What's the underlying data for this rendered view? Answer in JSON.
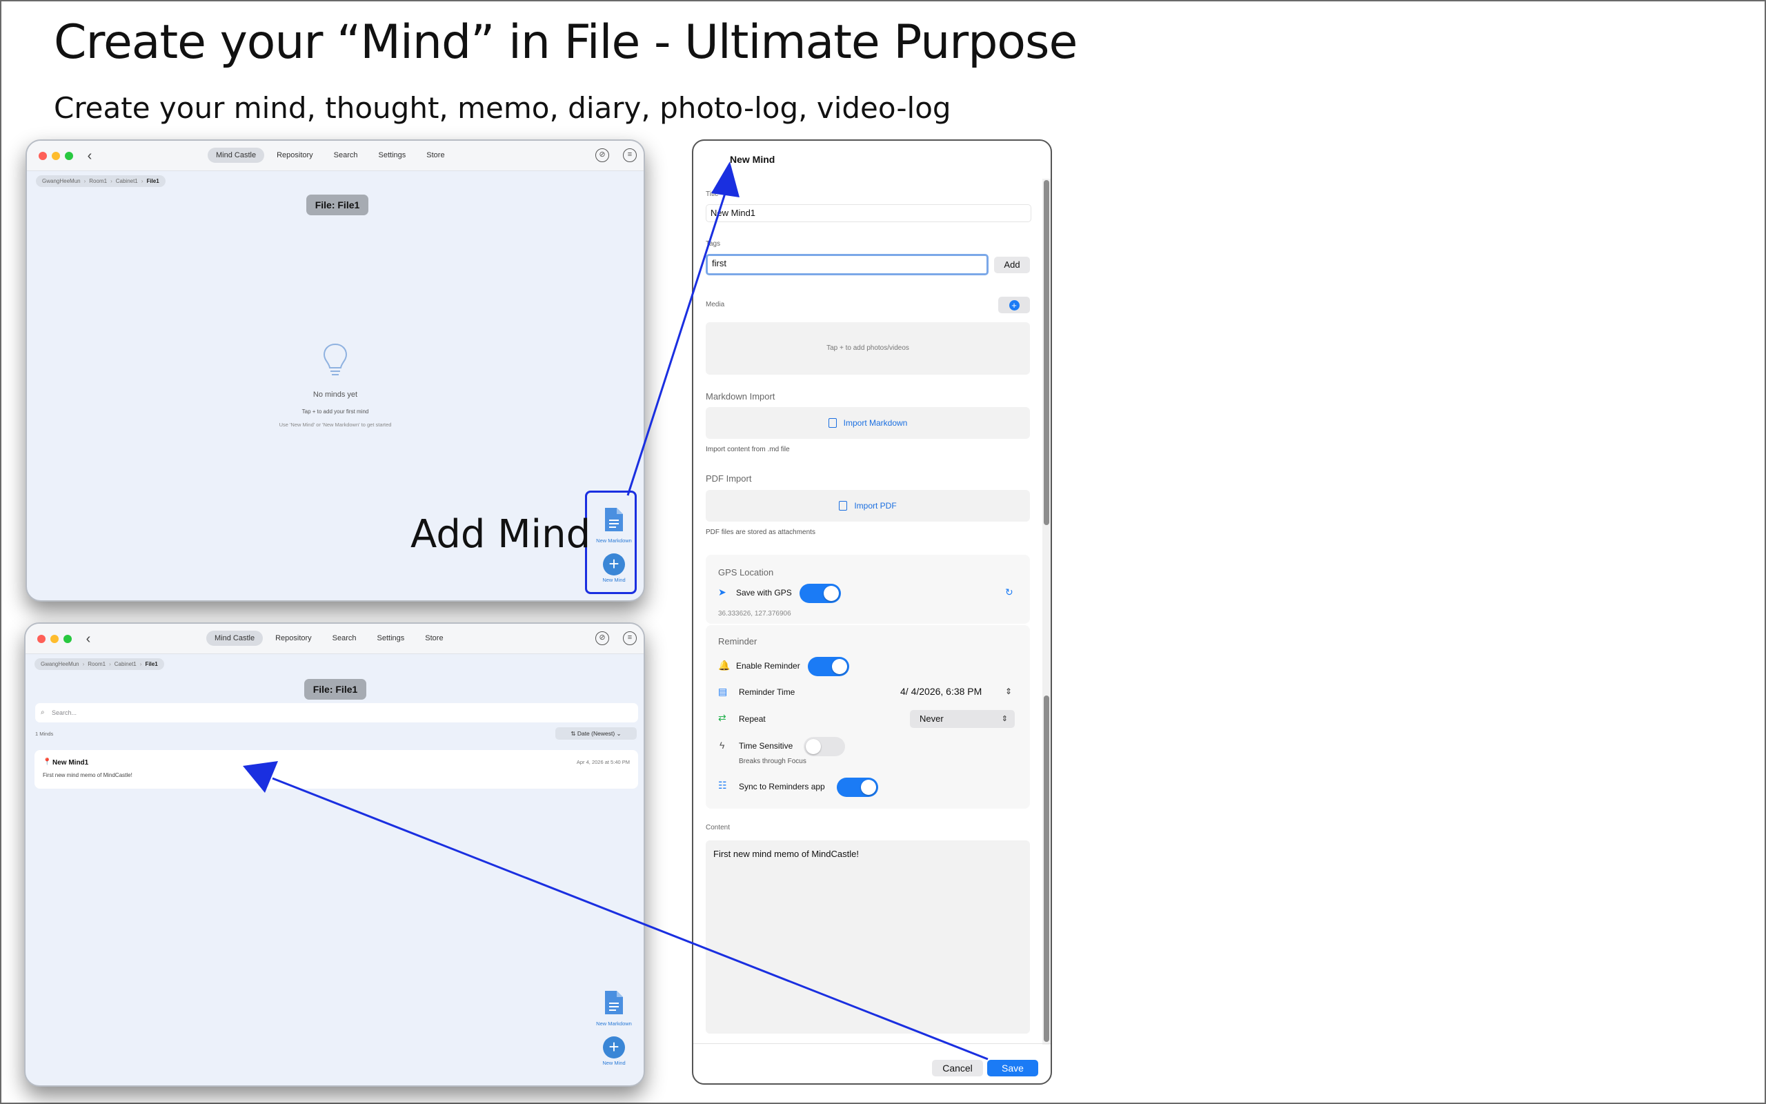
{
  "headline": "Create your “Mind” in File - Ultimate Purpose",
  "subline": "Create your mind, thought, memo, diary, photo-log, video-log",
  "add_mind_caption": "Add Mind",
  "app": {
    "tabs": [
      "Mind Castle",
      "Repository",
      "Search",
      "Settings",
      "Store"
    ],
    "active_tab": "Mind Castle",
    "back_icon": "chevron-left-icon",
    "breadcrumb": [
      "GwangHeeMun",
      "Room1",
      "Cabinet1",
      "File1"
    ],
    "file_title": "File: File1",
    "fab": {
      "markdown_label": "New Markdown",
      "mind_label": "New Mind"
    }
  },
  "window_empty": {
    "empty_title": "No minds yet",
    "empty_subtitle": "Tap + to add your first mind",
    "empty_hint": "Use 'New Mind' or 'New Markdown' to get started"
  },
  "window_list": {
    "search_placeholder": "Search...",
    "count_label": "1 Minds",
    "sort_label": "Date (Newest)",
    "minds": [
      {
        "title": "New Mind1",
        "date": "Apr 4, 2026 at 5:40 PM",
        "body": "First new mind memo of MindCastle!"
      }
    ]
  },
  "sheet": {
    "title": "New Mind",
    "title_label": "Title",
    "title_value": "New Mind1",
    "tags_label": "Tags",
    "tags_value": "first",
    "add_label": "Add",
    "media_label": "Media",
    "media_hint": "Tap + to add photos/videos",
    "markdown_import_label": "Markdown Import",
    "import_markdown_button": "Import Markdown",
    "markdown_note": "Import content from .md file",
    "pdf_import_label": "PDF Import",
    "import_pdf_button": "Import PDF",
    "pdf_note": "PDF files are stored as attachments",
    "gps_label": "GPS Location",
    "save_with_gps": "Save with GPS",
    "save_with_gps_on": true,
    "coords": "36.333626, 127.376906",
    "reminder_label": "Reminder",
    "enable_reminder": "Enable Reminder",
    "enable_reminder_on": true,
    "reminder_time_label": "Reminder Time",
    "reminder_time_value": "4/  4/2026,   6:38 PM",
    "repeat_label": "Repeat",
    "repeat_value": "Never",
    "time_sensitive_label": "Time Sensitive",
    "time_sensitive_on": false,
    "time_sensitive_note": "Breaks through Focus",
    "sync_label": "Sync to Reminders app",
    "sync_on": true,
    "content_label": "Content",
    "content_value": "First new mind memo of MindCastle!",
    "cancel_label": "Cancel",
    "save_label": "Save"
  },
  "colors": {
    "accent": "#1b7bf5",
    "annotation_arrow": "#1a2fe0",
    "window_bg": "#ecf1fa"
  }
}
